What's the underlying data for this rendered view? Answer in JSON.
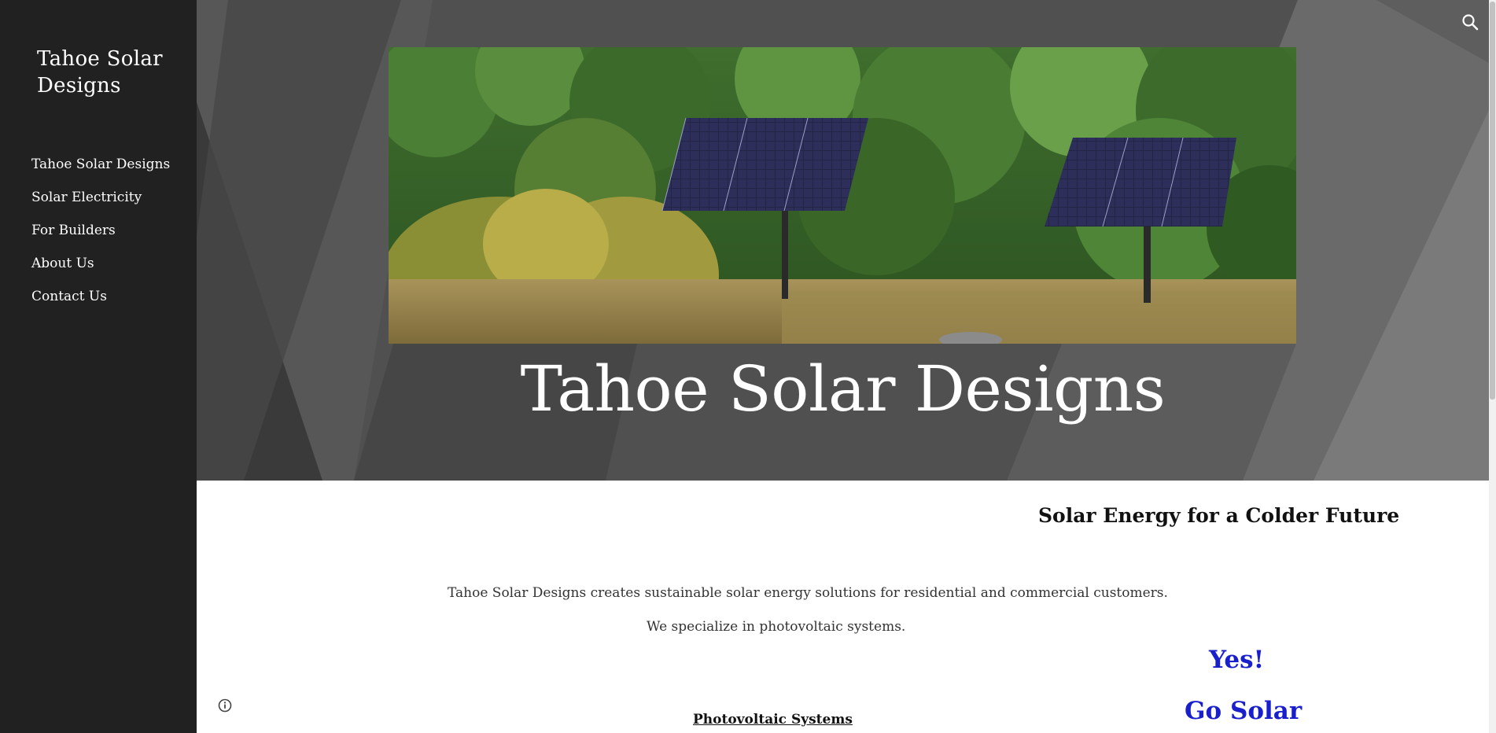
{
  "site": {
    "title": "Tahoe Solar Designs"
  },
  "nav": {
    "items": [
      {
        "label": "Tahoe Solar Designs"
      },
      {
        "label": "Solar Electricity"
      },
      {
        "label": "For Builders"
      },
      {
        "label": "About Us"
      },
      {
        "label": "Contact Us"
      }
    ]
  },
  "header": {
    "title": "Tahoe Solar Designs",
    "image": "solar-panels-in-forest-meadow"
  },
  "main": {
    "tagline": "Solar Energy for a Colder Future",
    "intro1": "Tahoe Solar Designs creates sustainable solar energy solutions for residential and commercial customers.",
    "intro2": "We specialize in photovoltaic systems.",
    "section_heading": "Photovoltaic Systems",
    "callout_yes": "Yes!",
    "callout_go": "Go Solar"
  },
  "icons": {
    "search": "search-icon",
    "info": "info-icon"
  },
  "colors": {
    "sidebar": "#212121",
    "header": "#4d4d4d",
    "callout": "#1a1fcc"
  }
}
